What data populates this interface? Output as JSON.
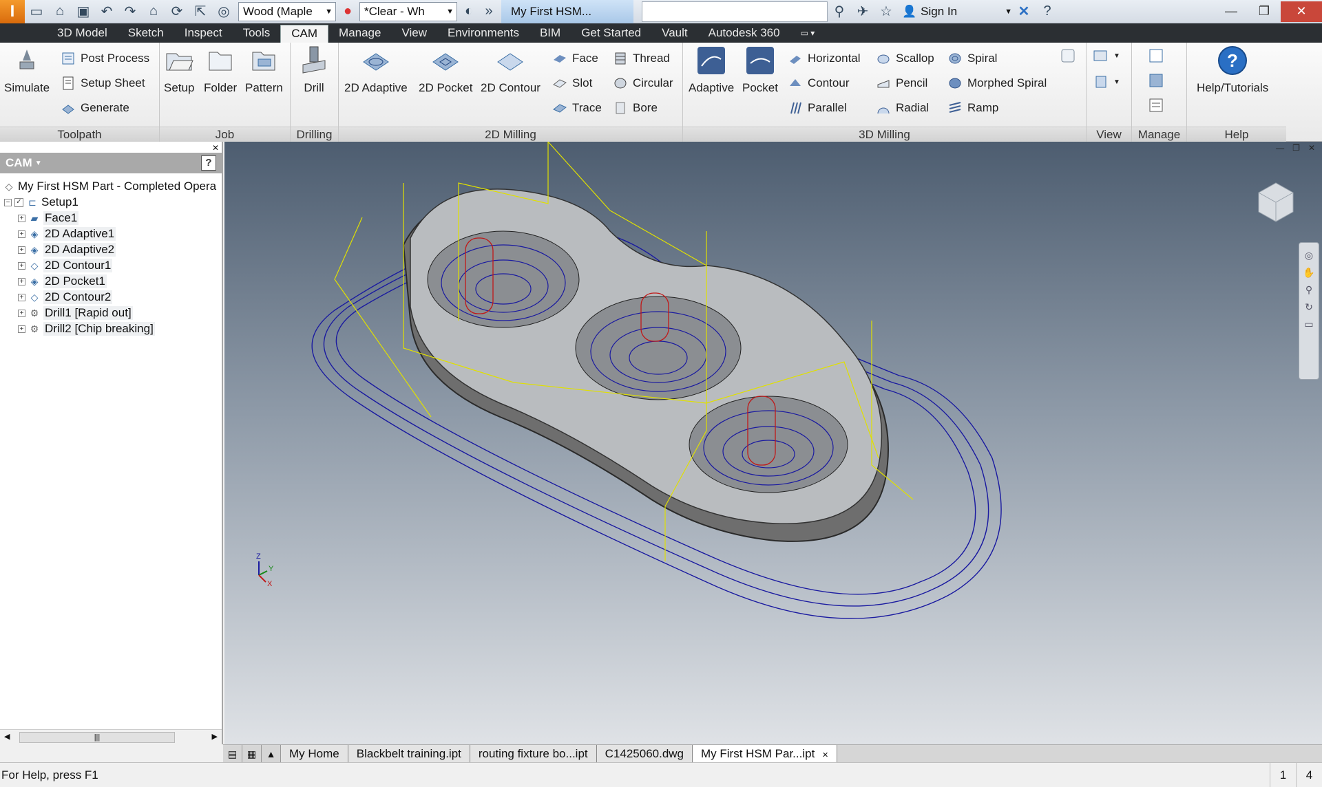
{
  "titlebar": {
    "material": "Wood (Maple",
    "appearance": "*Clear - Wh",
    "document_title": "My First HSM...",
    "signin_label": "Sign In"
  },
  "menu": {
    "tabs": [
      "3D Model",
      "Sketch",
      "Inspect",
      "Tools",
      "CAM",
      "Manage",
      "View",
      "Environments",
      "BIM",
      "Get Started",
      "Vault",
      "Autodesk 360"
    ],
    "active": "CAM"
  },
  "ribbon": {
    "toolpath": {
      "label": "Toolpath",
      "simulate": "Simulate",
      "post_process": "Post Process",
      "setup_sheet": "Setup Sheet",
      "generate": "Generate"
    },
    "job": {
      "label": "Job",
      "setup": "Setup",
      "folder": "Folder",
      "pattern": "Pattern"
    },
    "drilling": {
      "label": "Drilling",
      "drill": "Drill"
    },
    "milling2d": {
      "label": "2D Milling",
      "adaptive": "2D Adaptive",
      "pocket": "2D Pocket",
      "contour": "2D Contour",
      "face": "Face",
      "slot": "Slot",
      "trace": "Trace",
      "thread": "Thread",
      "circular": "Circular",
      "bore": "Bore"
    },
    "milling3d": {
      "label": "3D Milling",
      "adaptive": "Adaptive",
      "pocket": "Pocket",
      "horizontal": "Horizontal",
      "contour": "Contour",
      "parallel": "Parallel",
      "scallop": "Scallop",
      "pencil": "Pencil",
      "radial": "Radial",
      "spiral": "Spiral",
      "morphed_spiral": "Morphed Spiral",
      "ramp": "Ramp"
    },
    "view": {
      "label": "View"
    },
    "manage": {
      "label": "Manage"
    },
    "help": {
      "label": "Help",
      "tutorials": "Help/Tutorials"
    }
  },
  "browser": {
    "title": "CAM",
    "root": "My First HSM Part - Completed Opera",
    "setup": "Setup1",
    "operations": [
      "Face1",
      "2D Adaptive1",
      "2D Adaptive2",
      "2D Contour1",
      "2D Pocket1",
      "2D Contour2",
      "Drill1 [Rapid out]",
      "Drill2 [Chip breaking]"
    ]
  },
  "doc_tabs": [
    "My Home",
    "Blackbelt training.ipt",
    "routing fixture bo...ipt",
    "C1425060.dwg",
    "My First HSM Par...ipt"
  ],
  "status": {
    "text": "For Help, press F1",
    "count1": "1",
    "count2": "4"
  },
  "colors": {
    "accent": "#3a7bd5",
    "toolpath_blue": "#1a1aa0",
    "rapid_yellow": "#e0e000",
    "drill_red": "#c01818"
  }
}
